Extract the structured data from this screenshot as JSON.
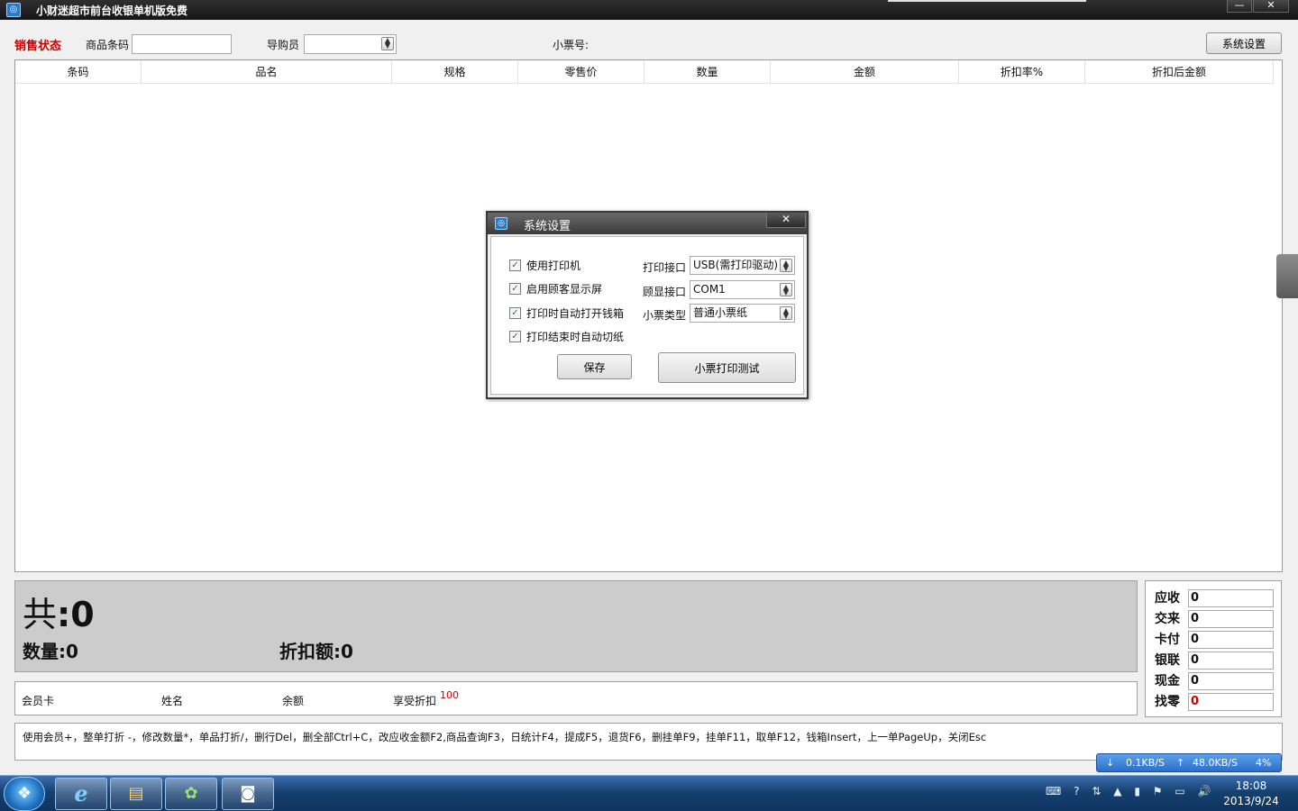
{
  "window": {
    "title": "小财迷超市前台收银单机版免费",
    "minimize_glyph": "—",
    "close_glyph": "✕",
    "app_icon_glyph": "◎"
  },
  "toolbar": {
    "sale_status": "销售状态",
    "barcode_label": "商品条码",
    "barcode_value": "",
    "guide_label": "导购员",
    "guide_value": "",
    "ticket_label": "小票号:",
    "ticket_value": "",
    "settings_button": "系统设置"
  },
  "grid": {
    "columns": [
      "条码",
      "品名",
      "规格",
      "零售价",
      "数量",
      "金额",
      "折扣率%",
      "折扣后金额"
    ],
    "rows": []
  },
  "summary": {
    "total_label": "共",
    "total_value": "0",
    "qty_label": "数量",
    "qty_value": "0",
    "discount_amount_label": "折扣额",
    "discount_amount_value": "0"
  },
  "payment": {
    "receivable_label": "应收",
    "receivable_value": "0",
    "paid_label": "交来",
    "paid_value": "0",
    "card_label": "卡付",
    "card_value": "0",
    "unionpay_label": "银联",
    "unionpay_value": "0",
    "cash_label": "现金",
    "cash_value": "0",
    "change_label": "找零",
    "change_value": "0",
    "change_color": "#cc0000"
  },
  "member": {
    "card_label": "会员卡",
    "name_label": "姓名",
    "balance_label": "余额",
    "discount_label": "享受折扣",
    "discount_value": "100"
  },
  "shortcuts": {
    "text": "使用会员+，整单打折 -，修改数量*，单品打折/，删行Del，删全部Ctrl+C，改应收金额F2,商品查询F3，日统计F4，提成F5，退货F6，删挂单F9，挂单F11，取单F12，钱箱Insert，上一单PageUp，关闭Esc"
  },
  "dialog": {
    "title": "系统设置",
    "close_glyph": "✕",
    "checkboxes": [
      {
        "label": "使用打印机",
        "checked": true
      },
      {
        "label": "启用顾客显示屏",
        "checked": true
      },
      {
        "label": "打印时自动打开钱箱",
        "checked": true
      },
      {
        "label": "打印结束时自动切纸",
        "checked": true
      }
    ],
    "check_glyph": "✓",
    "print_port_label": "打印接口",
    "print_port_value": "USB(需打印驱动)",
    "display_port_label": "顾显接口",
    "display_port_value": "COM1",
    "ticket_type_label": "小票类型",
    "ticket_type_value": "普通小票纸",
    "save_button": "保存",
    "print_test_button": "小票打印测试"
  },
  "netspeed": {
    "down": "0.1KB/S",
    "up": "48.0KB/S",
    "cpu": "4%",
    "down_glyph": "↓",
    "up_glyph": "↑"
  },
  "taskbar": {
    "start_glyph": "❖",
    "ie_glyph": "e",
    "explorer_glyph": "▤",
    "app3_glyph": "✿",
    "app4_glyph": "◙",
    "tray_icons": [
      "⌨",
      "?",
      "⇅",
      "▲",
      "▮",
      "⚑",
      "▭",
      "🔊"
    ],
    "time": "18:08",
    "date": "2013/9/24"
  },
  "colors": {
    "accent_red": "#cc0000",
    "summary_bg": "#cccccc",
    "taskbar": "#16406f"
  }
}
